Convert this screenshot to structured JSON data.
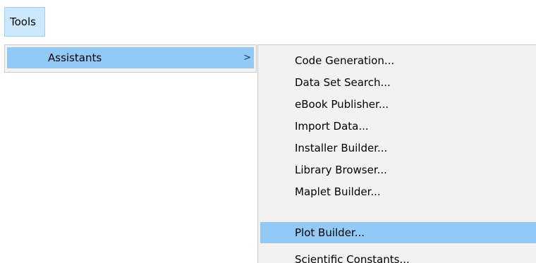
{
  "menubar": {
    "tools_label": "Tools"
  },
  "tools_menu": {
    "assistants_label": "Assistants",
    "submenu_arrow": ">"
  },
  "assistants_submenu": {
    "items": [
      {
        "label": "Code Generation...",
        "selected": false
      },
      {
        "label": "Data Set Search...",
        "selected": false
      },
      {
        "label": "eBook Publisher...",
        "selected": false
      },
      {
        "label": "Import Data...",
        "selected": false
      },
      {
        "label": "Installer Builder...",
        "selected": false
      },
      {
        "label": "Library Browser...",
        "selected": false
      },
      {
        "label": "Maplet Builder...",
        "selected": false
      },
      {
        "label": "Plot Builder...",
        "selected": true
      },
      {
        "label": "Scientific Constants...",
        "selected": false
      }
    ]
  },
  "colors": {
    "highlight": "#91c9f7",
    "menubar_active": "#cce8ff",
    "menu_background": "#f2f2f2"
  }
}
